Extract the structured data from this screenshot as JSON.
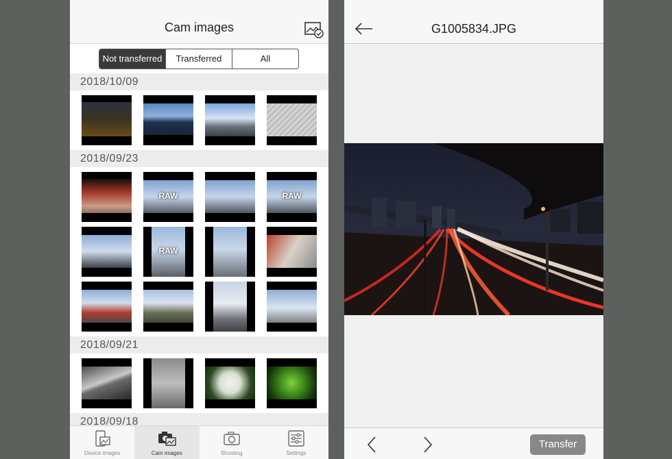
{
  "left": {
    "title": "Cam images",
    "segments": [
      "Not transferred",
      "Transferred",
      "All"
    ],
    "sections": [
      {
        "date": "2018/10/09",
        "thumbs": [
          {
            "raw": ""
          },
          {
            "raw": ""
          },
          {
            "raw": ""
          },
          {
            "raw": ""
          }
        ]
      },
      {
        "date": "2018/09/23",
        "thumbs": [
          {
            "raw": ""
          },
          {
            "raw": "RAW"
          },
          {
            "raw": ""
          },
          {
            "raw": "RAW"
          },
          {
            "raw": ""
          },
          {
            "raw": "RAW"
          },
          {
            "raw": ""
          },
          {
            "raw": ""
          },
          {
            "raw": ""
          },
          {
            "raw": ""
          },
          {
            "raw": ""
          },
          {
            "raw": ""
          }
        ]
      },
      {
        "date": "2018/09/21",
        "thumbs": [
          {
            "raw": ""
          },
          {
            "raw": ""
          },
          {
            "raw": ""
          },
          {
            "raw": ""
          }
        ]
      },
      {
        "date": "2018/09/18",
        "thumbs": []
      }
    ],
    "tabs": [
      {
        "label": "Device images",
        "icon": "device-images-icon"
      },
      {
        "label": "Cam images",
        "icon": "cam-images-icon"
      },
      {
        "label": "Shooting",
        "icon": "camera-icon"
      },
      {
        "label": "Settings",
        "icon": "settings-icon"
      }
    ]
  },
  "right": {
    "title": "G1005834.JPG",
    "transfer_label": "Transfer"
  }
}
